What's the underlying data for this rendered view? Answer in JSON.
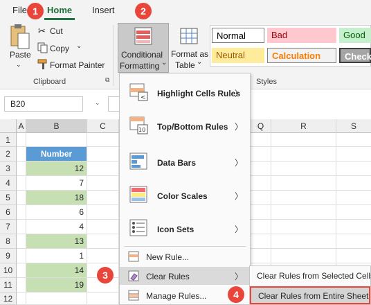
{
  "ribbon": {
    "tabs": [
      "File",
      "Home",
      "Insert"
    ],
    "clipboard": {
      "paste": "Paste",
      "cut": "Cut",
      "copy": "Copy",
      "format_painter": "Format Painter",
      "group_label": "Clipboard"
    },
    "conditional_formatting": {
      "line1": "Conditional",
      "line2": "Formatting"
    },
    "format_as_table": {
      "line1": "Format as",
      "line2": "Table"
    },
    "styles": {
      "items": [
        "Normal",
        "Bad",
        "Good",
        "Neutral",
        "Calculation",
        "Check"
      ],
      "group_label": "Styles"
    }
  },
  "badges": [
    "1",
    "2",
    "3",
    "4"
  ],
  "formula_bar": {
    "name_box": "B20"
  },
  "grid": {
    "columns": [
      "A",
      "B",
      "C",
      "Q",
      "R",
      "S"
    ],
    "rows": [
      "1",
      "2",
      "3",
      "4",
      "5",
      "6",
      "7",
      "8",
      "9",
      "10",
      "11",
      "12"
    ],
    "header": "Number",
    "values": [
      "12",
      "7",
      "18",
      "6",
      "4",
      "13",
      "1",
      "14",
      "19"
    ]
  },
  "menu": {
    "items": [
      "Highlight Cells Rules",
      "Top/Bottom Rules",
      "Data Bars",
      "Color Scales",
      "Icon Sets"
    ],
    "new_rule": "New Rule...",
    "clear_rules": "Clear Rules",
    "manage_rules": "Manage Rules..."
  },
  "submenu": {
    "items": [
      "Clear Rules from Selected Cells",
      "Clear Rules from Entire Sheet"
    ]
  },
  "colors": {
    "accent": "#217346",
    "badge": "#e8463a",
    "highlight": "#c6e0b4",
    "header": "#5b9bd5"
  }
}
